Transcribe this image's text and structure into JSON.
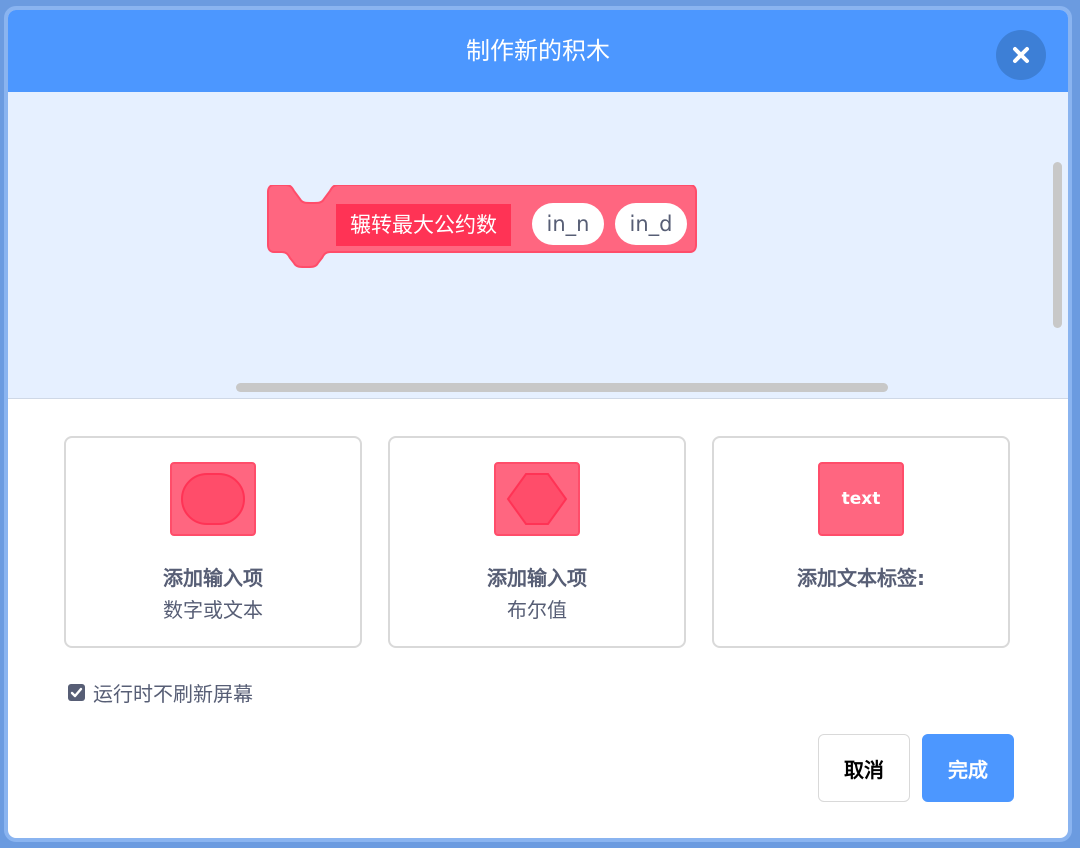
{
  "dialog": {
    "title": "制作新的积木",
    "close_icon": "close-icon"
  },
  "block": {
    "name": "辗转最大公约数",
    "args": [
      "in_n",
      "in_d"
    ],
    "color": "#ff6680",
    "label_bg": "#ff3355"
  },
  "options": [
    {
      "icon": "number-text-input-icon",
      "title": "添加输入项",
      "subtitle": "数字或文本"
    },
    {
      "icon": "boolean-input-icon",
      "title": "添加输入项",
      "subtitle": "布尔值"
    },
    {
      "icon": "text-label-icon",
      "icon_text": "text",
      "title": "添加文本标签:",
      "subtitle": ""
    }
  ],
  "checkbox": {
    "label": "运行时不刷新屏幕",
    "checked": true
  },
  "buttons": {
    "cancel": "取消",
    "ok": "完成"
  },
  "colors": {
    "header": "#4c97ff",
    "workspace": "#e6f0ff",
    "ok_button": "#4c97ff"
  }
}
